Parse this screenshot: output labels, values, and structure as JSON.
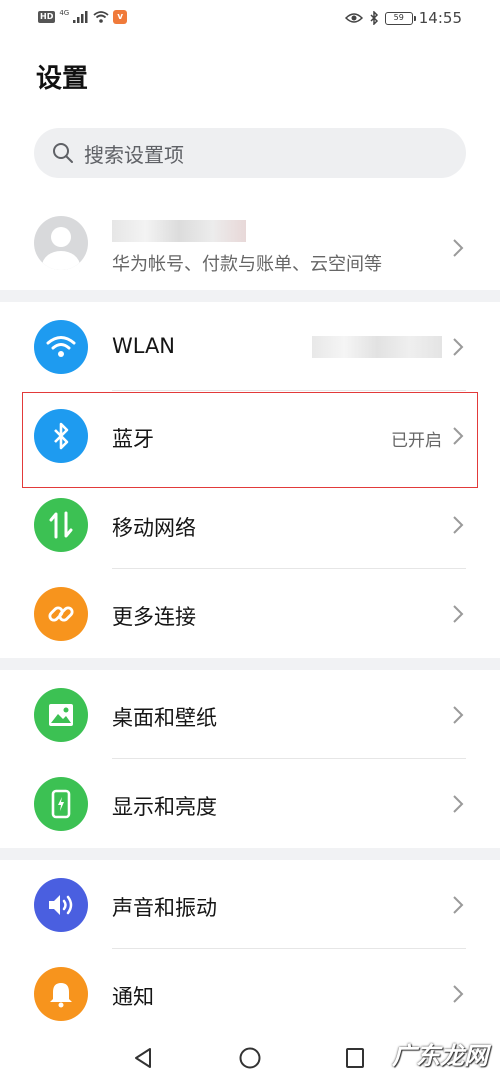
{
  "status_bar": {
    "hd": "HD",
    "network": "4G",
    "battery": "59",
    "time": "14:55"
  },
  "header": {
    "title": "设置"
  },
  "search": {
    "placeholder": "搜索设置项"
  },
  "account": {
    "subtitle": "华为帐号、付款与账单、云空间等"
  },
  "groups": [
    {
      "items": [
        {
          "label": "WLAN",
          "icon": "wifi-icon",
          "color": "#1e9bf0"
        },
        {
          "label": "蓝牙",
          "value": "已开启",
          "icon": "bluetooth-icon",
          "color": "#1e9bf0",
          "highlighted": true
        },
        {
          "label": "移动网络",
          "icon": "mobile-data-icon",
          "color": "#3cc153"
        },
        {
          "label": "更多连接",
          "icon": "link-icon",
          "color": "#f7941d"
        }
      ]
    },
    {
      "items": [
        {
          "label": "桌面和壁纸",
          "icon": "wallpaper-icon",
          "color": "#3cc153"
        },
        {
          "label": "显示和亮度",
          "icon": "display-icon",
          "color": "#3cc153"
        }
      ]
    },
    {
      "items": [
        {
          "label": "声音和振动",
          "icon": "sound-icon",
          "color": "#4a5fe0"
        },
        {
          "label": "通知",
          "icon": "bell-icon",
          "color": "#f7941d"
        }
      ]
    }
  ],
  "watermark": "广东龙网"
}
